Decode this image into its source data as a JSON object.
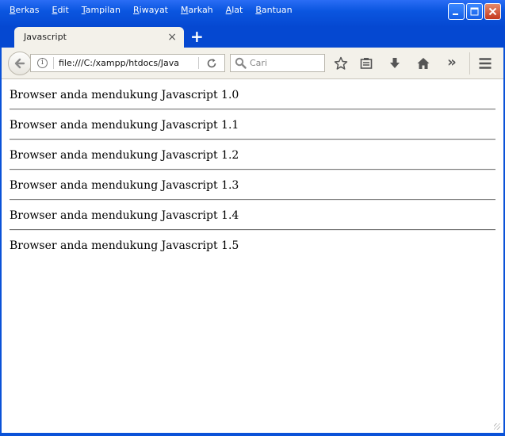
{
  "menu": {
    "items": [
      "Berkas",
      "Edit",
      "Tampilan",
      "Riwayat",
      "Markah",
      "Alat",
      "Bantuan"
    ]
  },
  "tab": {
    "title": "Javascript",
    "close_glyph": "×",
    "new_glyph": "+"
  },
  "navbar": {
    "url": "file:///C:/xampp/htdocs/Javascr",
    "info_glyph": "i",
    "search_placeholder": "Cari",
    "more_glyph": "»"
  },
  "content": {
    "lines": [
      "Browser anda mendukung Javascript 1.0",
      "Browser anda mendukung Javascript 1.1",
      "Browser anda mendukung Javascript 1.2",
      "Browser anda mendukung Javascript 1.3",
      "Browser anda mendukung Javascript 1.4",
      "Browser anda mendukung Javascript 1.5"
    ]
  },
  "colors": {
    "titlebar": "#0548d1",
    "chrome": "#f3f1ea",
    "text": "#000000"
  }
}
